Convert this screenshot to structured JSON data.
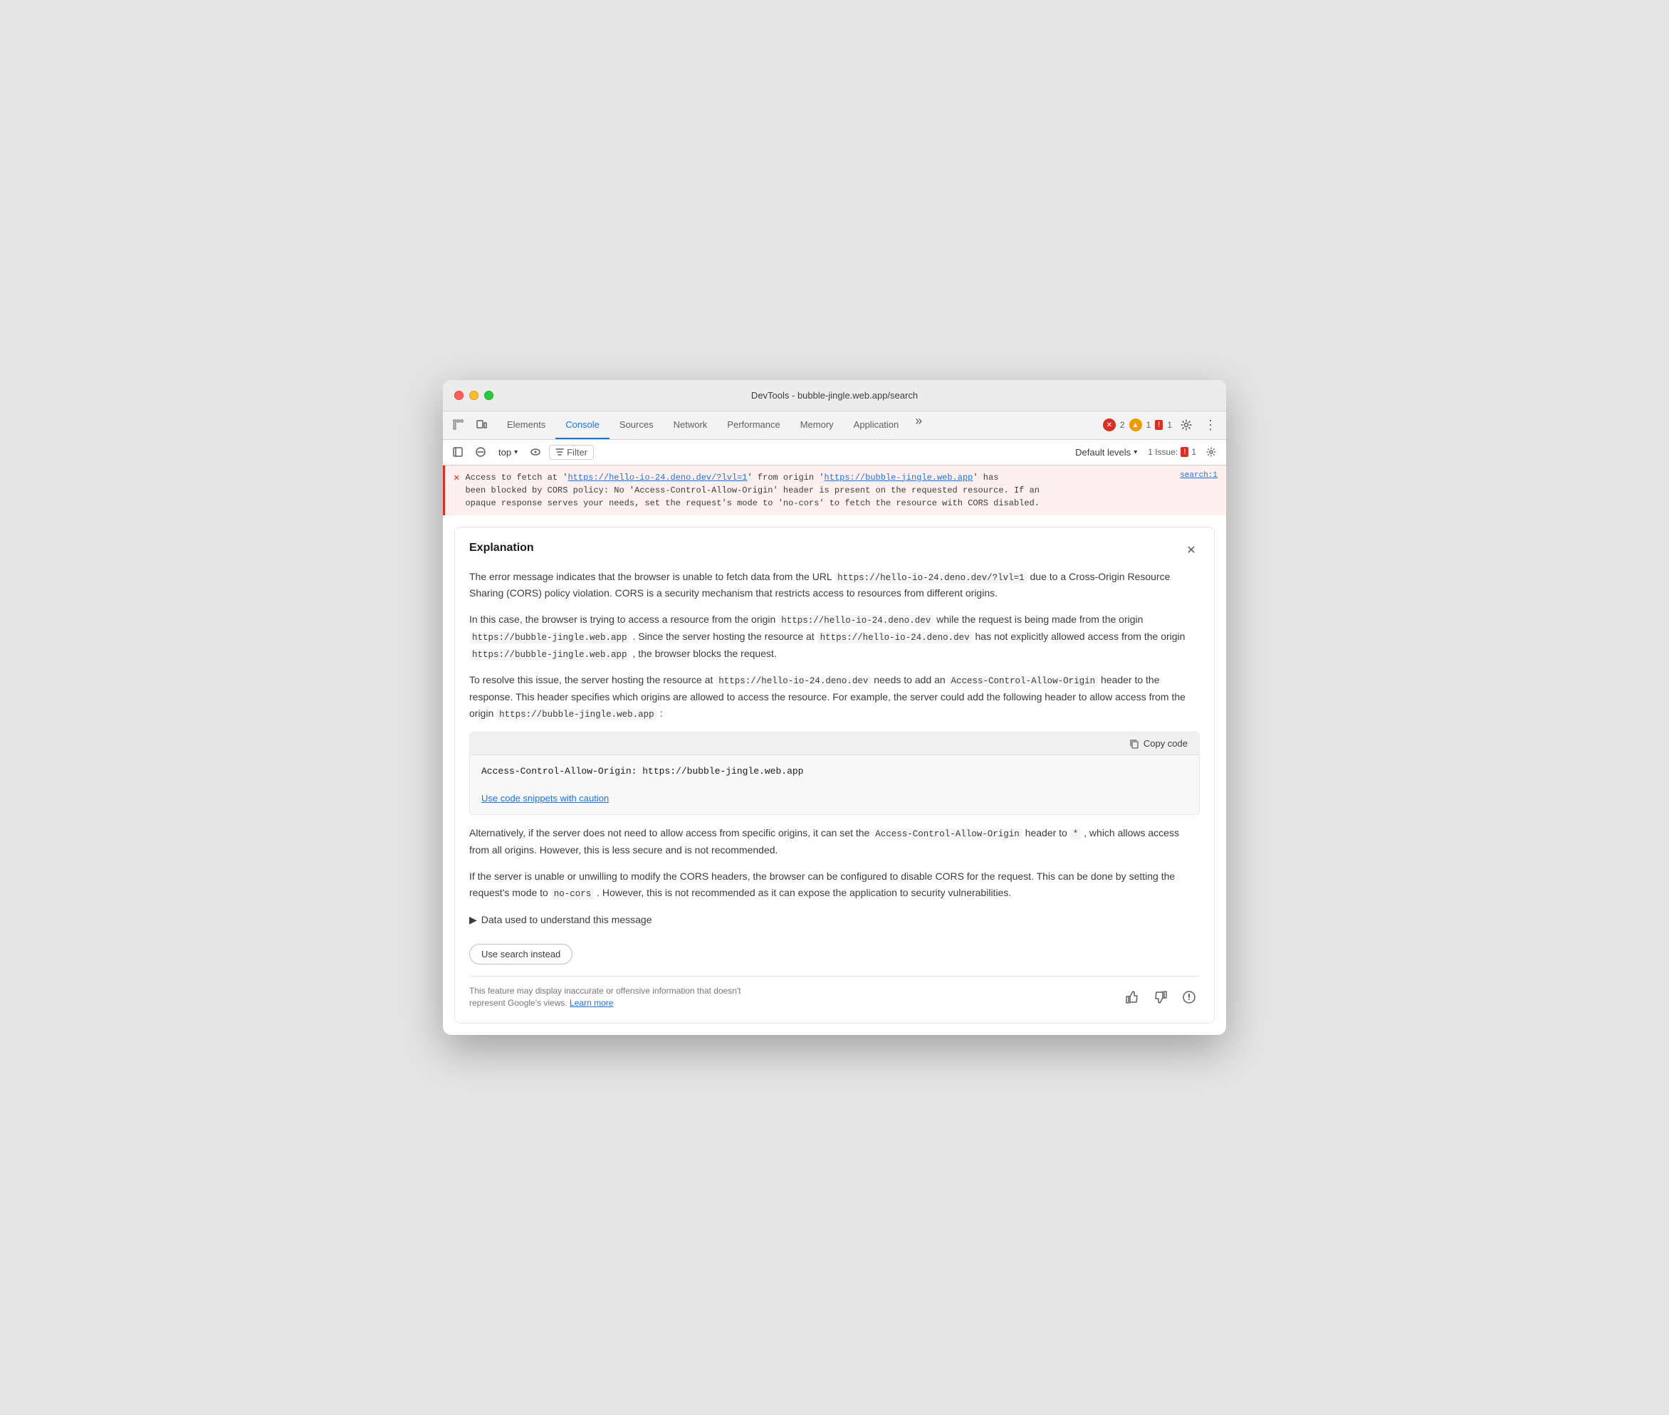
{
  "window": {
    "title": "DevTools - bubble-jingle.web.app/search"
  },
  "toolbar": {
    "tabs": [
      {
        "id": "elements",
        "label": "Elements",
        "active": false
      },
      {
        "id": "console",
        "label": "Console",
        "active": true
      },
      {
        "id": "sources",
        "label": "Sources",
        "active": false
      },
      {
        "id": "network",
        "label": "Network",
        "active": false
      },
      {
        "id": "performance",
        "label": "Performance",
        "active": false
      },
      {
        "id": "memory",
        "label": "Memory",
        "active": false
      },
      {
        "id": "application",
        "label": "Application",
        "active": false
      }
    ],
    "error_count": "2",
    "warn_count": "1",
    "issue_count": "1",
    "issues_label": "1 Issue:"
  },
  "filter_bar": {
    "context": "top",
    "filter_placeholder": "Filter",
    "default_levels": "Default levels",
    "issues_label": "1 Issue:"
  },
  "console": {
    "error_message": "Access to fetch at 'https://hello-io-24.deno.dev/?lvl=1' from origin 'https://bubble-jingle.web.app' has been blocked by CORS policy: No 'Access-Control-Allow-Origin' header is present on the requested resource. If an opaque response serves your needs, set the request's mode to 'no-cors' to fetch the resource with CORS disabled.",
    "error_url1": "https://hello-io-24.deno.dev/?lvl=1",
    "error_url2": "https://bubble-jingle.web.app",
    "error_source": "search:1"
  },
  "explanation": {
    "title": "Explanation",
    "para1": "The error message indicates that the browser is unable to fetch data from the URL",
    "para1_url": "https://hello-io-24.deno.dev/?lvl=1",
    "para1_cont": "due to a Cross-Origin Resource Sharing (CORS) policy violation. CORS is a security mechanism that restricts access to resources from different origins.",
    "para2_1": "In this case, the browser is trying to access a resource from the origin",
    "para2_origin1": "https://hello-io-24.deno.dev",
    "para2_2": "while the request is being made from the origin",
    "para2_origin2": "https://bubble-jingle.web.app",
    "para2_3": ". Since the server hosting the resource at",
    "para2_origin3": "https://hello-io-24.deno.dev",
    "para2_4": "has not explicitly allowed access from the origin",
    "para2_origin4": "https://bubble-jingle.web.app",
    "para2_5": ", the browser blocks the request.",
    "para3_1": "To resolve this issue, the server hosting the resource at",
    "para3_url": "https://hello-io-24.deno.dev",
    "para3_2": "needs to add an",
    "para3_header": "Access-Control-Allow-Origin",
    "para3_3": "header to the response. This header specifies which origins are allowed to access the resource. For example, the server could add the following header to allow access from the origin",
    "para3_origin": "https://bubble-jingle.web.app",
    "para3_4": ":",
    "code_snippet": "Access-Control-Allow-Origin: https://bubble-jingle.web.app",
    "copy_code_label": "Copy code",
    "code_caution_label": "Use code snippets with caution",
    "para4_1": "Alternatively, if the server does not need to allow access from specific origins, it can set the",
    "para4_header": "Access-Control-Allow-Origin",
    "para4_2": "header to",
    "para4_star": "*",
    "para4_3": ", which allows access from all origins. However, this is less secure and is not recommended.",
    "para5_1": "If the server is unable or unwilling to modify the CORS headers, the browser can be configured to disable CORS for the request. This can be done by setting the request's mode to",
    "para5_code": "no-cors",
    "para5_2": ". However, this is not recommended as it can expose the application to security vulnerabilities.",
    "data_used_label": "Data used to understand this message",
    "use_search_label": "Use search instead",
    "disclaimer": "This feature may display inaccurate or offensive information that doesn't represent Google's views.",
    "learn_more": "Learn more"
  }
}
